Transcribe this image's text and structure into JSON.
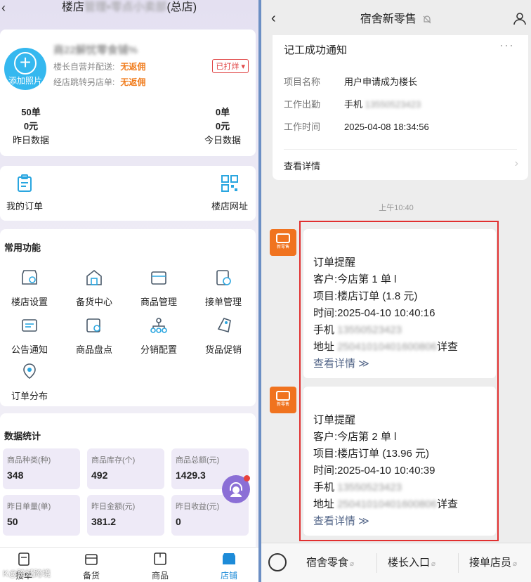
{
  "left": {
    "header": {
      "title_prefix": "楼店",
      "title_blurred": "管理•零点小卖部",
      "title_suffix": "(总店)"
    },
    "store": {
      "add_photo": "添加照片",
      "name": "商22解忧零食铺%",
      "line1_label": "楼长自营并配送:",
      "line1_value": "无返佣",
      "line2_label": "经店跳转另店单:",
      "line2_value": "无返佣",
      "print_tag": "已打烊 ▾",
      "stats": [
        {
          "orders": "50单",
          "amount": "0元",
          "label": "昨日数据"
        },
        {
          "orders": "0单",
          "amount": "0元",
          "label": "今日数据"
        }
      ]
    },
    "quick": {
      "orders": "我的订单",
      "url": "楼店网址"
    },
    "functions": {
      "title": "常用功能",
      "items": [
        "楼店设置",
        "备货中心",
        "商品管理",
        "接单管理",
        "公告通知",
        "商品盘点",
        "分销配置",
        "货品促销",
        "订单分布"
      ]
    },
    "data_stats": {
      "title": "数据统计",
      "cells": [
        {
          "label": "商品种类(种)",
          "value": "348"
        },
        {
          "label": "商品库存(个)",
          "value": "492"
        },
        {
          "label": "商品总额(元)",
          "value": "1429.3"
        },
        {
          "label": "昨日单量(单)",
          "value": "50"
        },
        {
          "label": "昨日金额(元)",
          "value": "381.2"
        },
        {
          "label": "昨日收益(元)",
          "value": "0"
        }
      ]
    },
    "tabbar": {
      "tabs": [
        "接单",
        "备货",
        "商品",
        "店铺"
      ],
      "active": "店铺"
    },
    "watermark": "K@跨域跨境"
  },
  "right": {
    "header": {
      "title": "宿舍新零售"
    },
    "notice": {
      "title": "记工成功通知",
      "more": "···",
      "rows": [
        {
          "k": "项目名称",
          "v": "用户申请成为楼长"
        },
        {
          "k": "工作出勤",
          "v": "手机",
          "v_blur": "13550523423"
        },
        {
          "k": "工作时间",
          "v": "2025-04-08 18:34:56"
        }
      ],
      "view": "查看详情"
    },
    "time": "上午10:40",
    "avatar_text": "新零售",
    "messages": [
      {
        "title": "订单提醒",
        "customer": "客户:今店第 1 单 l",
        "project": "项目:楼店订单 (1.8 元)",
        "time": "时间:2025-04-10 10:40:16",
        "phone_label": "手机",
        "phone_blur": "13550523423",
        "addr_label": "地址",
        "addr_blur": "25041010401600806",
        "addr_tail": "详查",
        "link": "查看详情 ≫"
      },
      {
        "title": "订单提醒",
        "customer": "客户:今店第 2 单 l",
        "project": "项目:楼店订单 (13.96 元)",
        "time": "时间:2025-04-10 10:40:39",
        "phone_label": "手机",
        "phone_blur": "13550523423",
        "addr_label": "地址",
        "addr_blur": "25041010401600806",
        "addr_tail": "详查",
        "link": "查看详情 ≫"
      }
    ],
    "bottom_menu": [
      "宿舍零食",
      "楼长入口",
      "接单店员"
    ]
  },
  "colors": {
    "accent_blue": "#2aa6e0",
    "orange": "#f07b1b",
    "highlight_red": "#e12f2f",
    "purple": "#8b6fd6"
  }
}
